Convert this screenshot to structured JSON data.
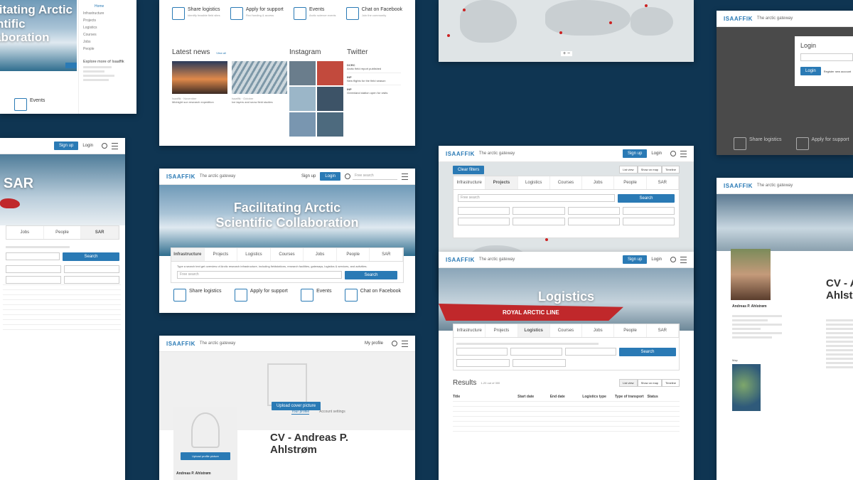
{
  "brand": {
    "logo": "ISAAFFIK",
    "tagline": "The arctic gateway"
  },
  "header": {
    "signup": "Sign up",
    "login": "Login",
    "search_placeholder": "Free search"
  },
  "hero": {
    "title": "Facilitating Arctic Scientific Collaboration",
    "search_hint": "Type a search text get overview of Arctic research infrastructure, including fieldstations, research facilities, gateways, logistics & services, and activities.",
    "search_button": "Search"
  },
  "tabs": [
    "Infrastructure",
    "Projects",
    "Logistics",
    "Courses",
    "Jobs",
    "People",
    "SAR"
  ],
  "services": [
    {
      "title": "Share logistics",
      "text": "Identify feasible field sites"
    },
    {
      "title": "Apply for support",
      "text": "Find funding & access"
    },
    {
      "title": "Events",
      "text": "Arctic science events"
    },
    {
      "title": "Chat on Facebook",
      "text": "Join the community"
    }
  ],
  "news": {
    "heading": "Latest news",
    "more": "View all",
    "items": [
      {
        "date": "Isaaffik · November",
        "text": "Midnight sun research expedition"
      },
      {
        "date": "Isaaffik · October",
        "text": "Ice layers and snow field studies"
      }
    ]
  },
  "instagram": {
    "heading": "Instagram"
  },
  "twitter": {
    "heading": "Twitter",
    "tweets": [
      {
        "user": "DCRC",
        "text": "Arctic field report published"
      },
      {
        "user": "INP",
        "text": "New flights for the field season"
      },
      {
        "user": "INP",
        "text": "Greenland station open for visits"
      }
    ]
  },
  "sar": {
    "title": "SAR",
    "search": "Search"
  },
  "logistics": {
    "title": "Logistics",
    "results_label": "Results",
    "results_count": "1-20 out of 300",
    "ship_text": "ROYAL ARCTIC LINE",
    "list_btn": "List view",
    "map_btn": "Show on map",
    "timeline_btn": "Timeline",
    "columns": [
      "Title",
      "Start date",
      "End date",
      "Logistics type",
      "Type of transport",
      "Status"
    ]
  },
  "map": {
    "clear_filters": "Clear filters",
    "list_view": "List view",
    "map_view": "Show on map",
    "timeline": "Timeline",
    "search": "Search"
  },
  "profile": {
    "upload_photo": "Upload cover picture",
    "upload_profile": "Upload profile picture",
    "tab_profile": "Your profile",
    "tab_account": "Account settings",
    "cv_title": "CV - Andreas P. Ahlstrøm",
    "name": "Andreas P. Ahlstrøm",
    "my_profile": "My profile"
  },
  "cv2": {
    "title": "CV - Andreas P. Ahlstrøm",
    "name": "Andreas P. Ahlstrøm",
    "map_label": "Map"
  },
  "login_card": {
    "title": "Login",
    "button": "Login",
    "register": "Register new account"
  },
  "sidebar_menu": {
    "home": "Home",
    "items": [
      "Infrastructure",
      "Projects",
      "Logistics",
      "Courses",
      "Jobs",
      "People"
    ],
    "explore": "Explore more of Isaaffik"
  },
  "colors": {
    "primary": "#2a7ab5",
    "background": "#0f3552",
    "map_marker": "#cc2222"
  }
}
